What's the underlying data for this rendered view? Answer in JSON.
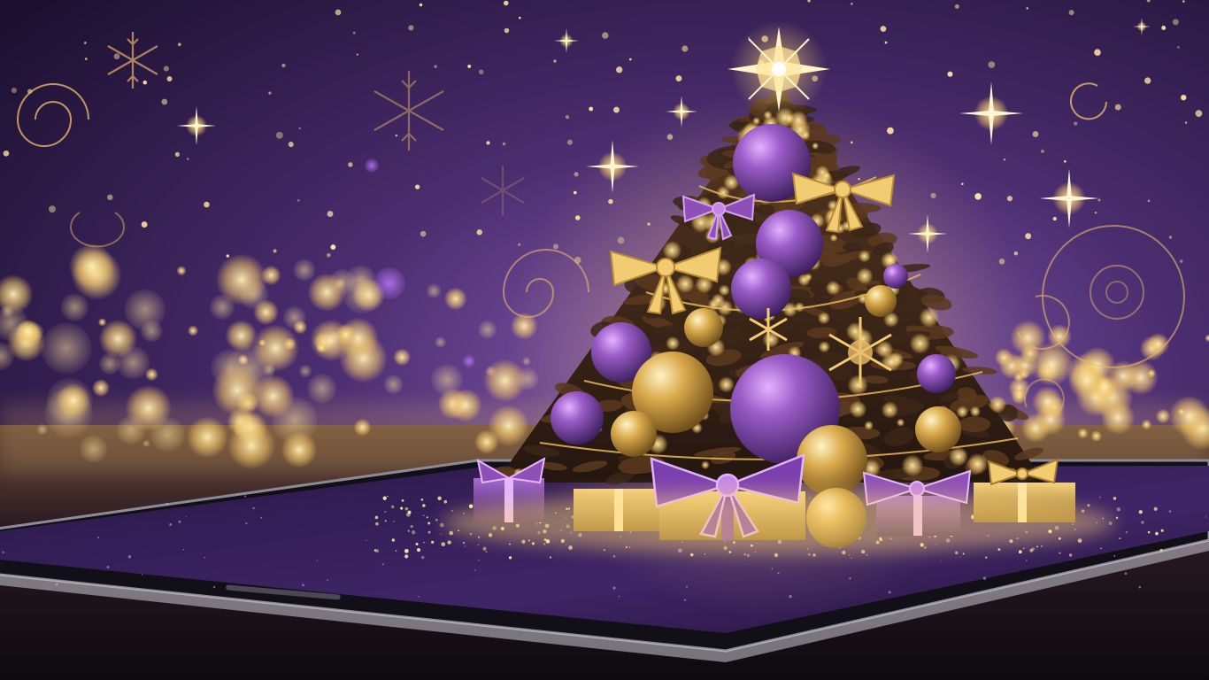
{
  "scene": {
    "description_kind": "illustration",
    "subject": "christmas-tree-rising-from-tablet",
    "palette": {
      "sky_top": "#1c1030",
      "sky_mid": "#4a2d6e",
      "sky_glow": "#8a5fb4",
      "gold": "#f3c86a",
      "gold_bright": "#fff1b8",
      "purple_ornament": "#8e4fb6",
      "purple_deep": "#3a1d5a",
      "tree_dark": "#2a1a1a",
      "tablet_frame": "#1e1a24",
      "tablet_screen": "#35205a"
    },
    "elements": [
      "star-topper",
      "christmas-tree",
      "purple-ornaments",
      "gold-ornaments",
      "gold-bows",
      "purple-bows",
      "gift-boxes",
      "bokeh-lights",
      "snowflakes",
      "swirls",
      "sparkle-stars",
      "tablet-device"
    ]
  }
}
